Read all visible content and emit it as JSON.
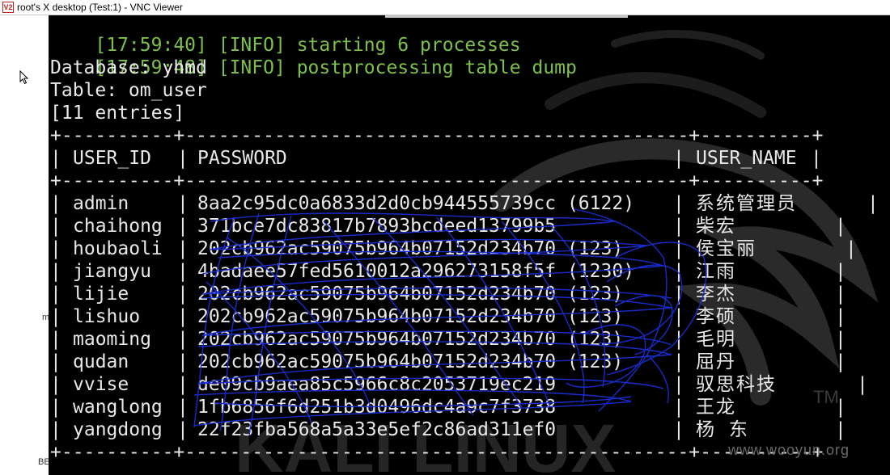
{
  "window": {
    "title": "root's X desktop (Test:1) - VNC Viewer",
    "icon_label": "V2"
  },
  "desktop": {
    "edge_letter_m": "m",
    "edge_letter_be": "BE"
  },
  "terminal": {
    "log_lines": [
      {
        "time": "[17:59:40]",
        "level": "[INFO]",
        "msg": "starting 6 processes"
      },
      {
        "time": "[17:59:48]",
        "level": "[INFO]",
        "msg": "postprocessing table dump"
      }
    ],
    "database_line": "Database: yhmd",
    "table_line": "Table: om_user",
    "entries_line": "[11 entries]",
    "border": "+----------+---------------------------------------------+----------+",
    "headers": {
      "user_id": "USER_ID",
      "password": "PASSWORD",
      "user_name": "USER_NAME"
    },
    "rows": [
      {
        "user_id": "admin",
        "password": "8aa2c95dc0a6833d2d0cb944555739cc (6122)",
        "user_name": "系统管理员"
      },
      {
        "user_id": "chaihong",
        "password": "371bce7dc83817b7893bcdeed13799b5",
        "user_name": "柴宏"
      },
      {
        "user_id": "houbaoli",
        "password": "202cb962ac59075b964b07152d234b70 (123)",
        "user_name": "侯宝丽"
      },
      {
        "user_id": "jiangyu",
        "password": "4badaee57fed5610012a296273158f5f (1230)",
        "user_name": "江雨"
      },
      {
        "user_id": "lijie",
        "password": "202cb962ac59075b964b07152d234b70 (123)",
        "user_name": "李杰"
      },
      {
        "user_id": "lishuo",
        "password": "202cb962ac59075b964b07152d234b70 (123)",
        "user_name": "李硕"
      },
      {
        "user_id": "maoming",
        "password": "202cb962ac59075b964b07152d234b70 (123)",
        "user_name": "毛明"
      },
      {
        "user_id": "qudan",
        "password": "202cb962ac59075b964b07152d234b70 (123)",
        "user_name": "屈丹"
      },
      {
        "user_id": "vvise",
        "password": "de09cb9aea85c5966c8c2053719ec219",
        "user_name": "驭思科技"
      },
      {
        "user_id": "wanglong",
        "password": "1fb6856f6d251b3d0496dc4a9c7f3738",
        "user_name": "王龙"
      },
      {
        "user_id": "yangdong",
        "password": "22f23fba568a5a33e5ef2c86ad311ef0",
        "user_name": "杨 东"
      }
    ]
  },
  "wallpaper": {
    "brand_text": "KALI LINUX",
    "tm": "TM"
  },
  "watermark": "www.wooyun.org",
  "colors": {
    "log_green": "#7cc04a",
    "text": "#e8e8e8",
    "scribble": "#1a2fd6"
  }
}
